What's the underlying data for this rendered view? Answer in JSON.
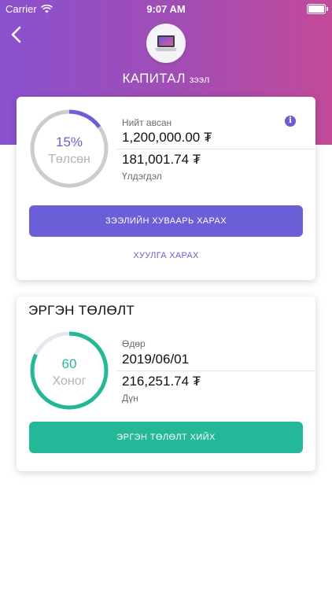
{
  "status_bar": {
    "carrier": "Carrier",
    "time": "9:07 AM"
  },
  "header": {
    "title": "КАПИТАЛ",
    "title_sub": "зээл",
    "colors": {
      "gradient_start": "#8a51cf",
      "gradient_end": "#c24a99"
    }
  },
  "loan_card": {
    "progress": {
      "percent_value": 15,
      "percent_text": "15%",
      "caption": "Төлсөн"
    },
    "total_label": "Нийт авсан",
    "total_value": "1,200,000.00 ₮",
    "remaining_value": "181,001.74 ₮",
    "remaining_label": "Үлдэгдэл",
    "schedule_button": "ЗЭЭЛИЙН ХУВААРЬ ХАРАХ",
    "history_link": "ХУУЛГА ХАРАХ",
    "accent_color": "#6b5fd8"
  },
  "repayment_card": {
    "title": "ЭРГЭН ТӨЛӨЛТ",
    "days": {
      "value": "60",
      "caption": "Хоног",
      "fraction": 0.82
    },
    "date_label": "Өдөр",
    "date_value": "2019/06/01",
    "amount_value": "216,251.74 ₮",
    "amount_label": "Дүн",
    "pay_button": "ЭРГЭН ТӨЛӨЛТ ХИЙХ",
    "accent_color": "#24b898"
  }
}
